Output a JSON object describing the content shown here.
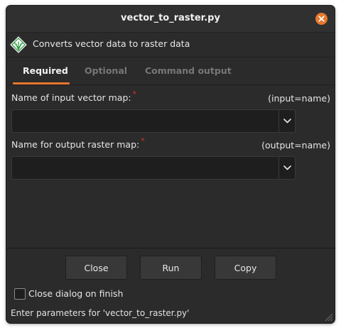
{
  "window": {
    "title": "vector_to_raster.py"
  },
  "description": "Converts vector data to raster data",
  "tabs": [
    {
      "label": "Required",
      "active": true
    },
    {
      "label": "Optional",
      "active": false
    },
    {
      "label": "Command output",
      "active": false
    }
  ],
  "fields": [
    {
      "label": "Name of input vector map:",
      "param": "(input=name)",
      "value": ""
    },
    {
      "label": "Name for output raster map:",
      "param": "(output=name)",
      "value": ""
    }
  ],
  "buttons": {
    "close": "Close",
    "run": "Run",
    "copy": "Copy"
  },
  "checkbox": {
    "label": "Close dialog on finish",
    "checked": false
  },
  "status": "Enter parameters for 'vector_to_raster.py'",
  "colors": {
    "accent": "#e7772c",
    "required_marker": "#e0341e",
    "background": "#2b2b2b"
  },
  "icons": {
    "close": "close-icon",
    "app": "grass-module-icon",
    "dropdown": "chevron-down-icon"
  }
}
